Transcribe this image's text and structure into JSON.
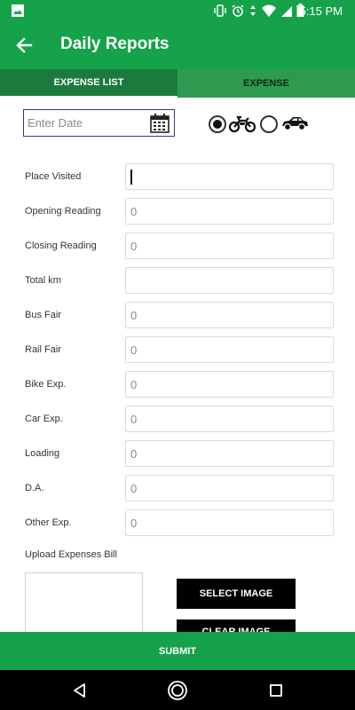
{
  "status_bar": {
    "time": "5:15 PM"
  },
  "app_bar": {
    "title": "Daily Reports"
  },
  "tabs": [
    {
      "label": "EXPENSE LIST"
    },
    {
      "label": "EXPENSE"
    }
  ],
  "date_field": {
    "placeholder": "Enter Date"
  },
  "vehicle": {
    "options": [
      "bike",
      "car"
    ],
    "selected": "bike"
  },
  "form": {
    "rows": [
      {
        "label": "Place Visited",
        "value": ""
      },
      {
        "label": "Opening Reading",
        "value": "0"
      },
      {
        "label": "Closing Reading",
        "value": "0"
      },
      {
        "label": "Total km",
        "value": ""
      },
      {
        "label": "Bus Fair",
        "value": "0"
      },
      {
        "label": "Rail Fair",
        "value": "0"
      },
      {
        "label": "Bike Exp.",
        "value": "0"
      },
      {
        "label": "Car Exp.",
        "value": "0"
      },
      {
        "label": "Loading",
        "value": "0"
      },
      {
        "label": "D.A.",
        "value": "0"
      },
      {
        "label": "Other Exp.",
        "value": "0"
      }
    ]
  },
  "upload": {
    "label": "Upload Expenses Bill",
    "select_label": "SELECT IMAGE",
    "clear_label": "CLEAR IMAGE"
  },
  "submit_label": "SUBMIT",
  "colors": {
    "primary": "#16a24a",
    "tab_active": "#1d7a3d",
    "tab_inactive": "#2e9a50"
  }
}
